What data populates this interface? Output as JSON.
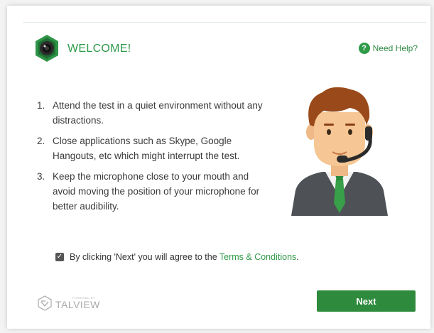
{
  "header": {
    "title": "WELCOME!",
    "help_label": "Need Help?",
    "help_icon_glyph": "?"
  },
  "instructions": [
    {
      "number": "1.",
      "text": "Attend the test in a quiet environment without any distractions."
    },
    {
      "number": "2.",
      "text": "Close applications such as Skype, Google Hangouts, etc which might interrupt the test."
    },
    {
      "number": "3.",
      "text": "Keep the microphone close to your mouth and avoid moving the position of your microphone for better audibility."
    }
  ],
  "agreement": {
    "checked": true,
    "checkbox_glyph": "✓",
    "text": "By clicking 'Next' you will agree to the ",
    "link_text": "Terms & Conditions",
    "suffix": "."
  },
  "footer": {
    "powered_by": "POWERED BY",
    "brand": "TALVIEW",
    "next_label": "Next"
  },
  "colors": {
    "accent": "#2f9a49",
    "button": "#2e8b3d"
  },
  "icons": {
    "logo": "camera-lens-hexagon-icon",
    "help": "question-circle-icon",
    "avatar": "headset-agent-icon",
    "brand": "talview-logo-icon"
  }
}
